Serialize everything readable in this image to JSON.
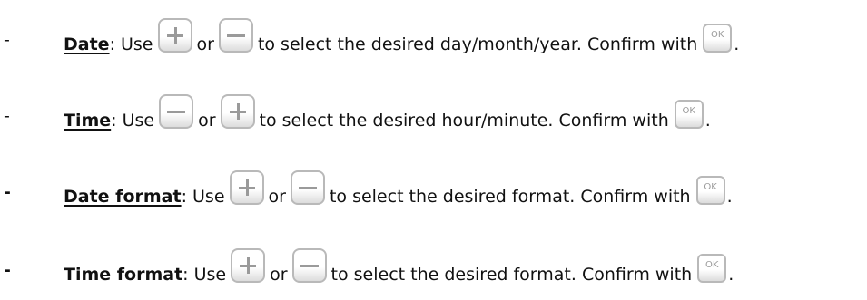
{
  "bullet": "-",
  "ok_label": "OK",
  "separator": "or",
  "items": [
    {
      "term": "Date",
      "use": ": Use ",
      "action": " to select the desired day/month/year. Confirm with ",
      "end": ".",
      "buttons": [
        "plus-icon",
        "minus-icon"
      ]
    },
    {
      "term": "Time",
      "use": ": Use ",
      "action": " to select the desired hour/minute. Confirm with ",
      "end": ".",
      "buttons": [
        "minus-icon",
        "plus-icon"
      ]
    },
    {
      "term": "Date format",
      "use": ": Use ",
      "action": " to select the desired format. Confirm with ",
      "end": ".",
      "buttons": [
        "plus-icon",
        "minus-icon"
      ]
    },
    {
      "term": "Time format",
      "use": ": Use ",
      "action": " to select the desired format. Confirm with ",
      "end": ".",
      "buttons": [
        "plus-icon",
        "minus-icon"
      ]
    }
  ]
}
